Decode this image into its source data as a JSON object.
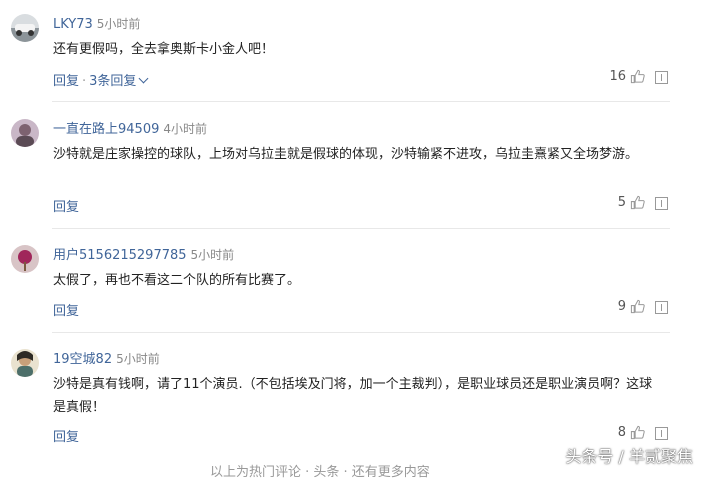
{
  "comments": [
    {
      "username": "LKY73",
      "time": "5小时前",
      "text": "还有更假吗，全去拿奥斯卡小金人吧！",
      "reply_label": "回复",
      "replies_label": "3条回复",
      "likes": "16"
    },
    {
      "username": "一直在路上94509",
      "time": "4小时前",
      "text": "沙特就是庄家操控的球队，上场对乌拉圭就是假球的体现，沙特输紧不进攻，乌拉圭熹紧又全场梦游。",
      "reply_label": "回复",
      "likes": "5"
    },
    {
      "username": "用户5156215297785",
      "time": "5小时前",
      "text": "太假了，再也不看这二个队的所有比赛了。",
      "reply_label": "回复",
      "likes": "9"
    },
    {
      "username": "19空城82",
      "time": "5小时前",
      "text": "沙特是真有钱啊，请了11个演员.（不包括埃及门将，加一个主裁判），是职业球员还是职业演员啊？这球是真假！",
      "reply_label": "回复",
      "likes": "8"
    }
  ],
  "icons": {
    "like": "thumbs-up-icon",
    "report": "report-icon",
    "expand": "chevron-down-icon"
  },
  "watermark": "头条号 / 羊贰聚焦",
  "footer_hint": "以上为热门评论 · 头条 · 还有更多内容"
}
